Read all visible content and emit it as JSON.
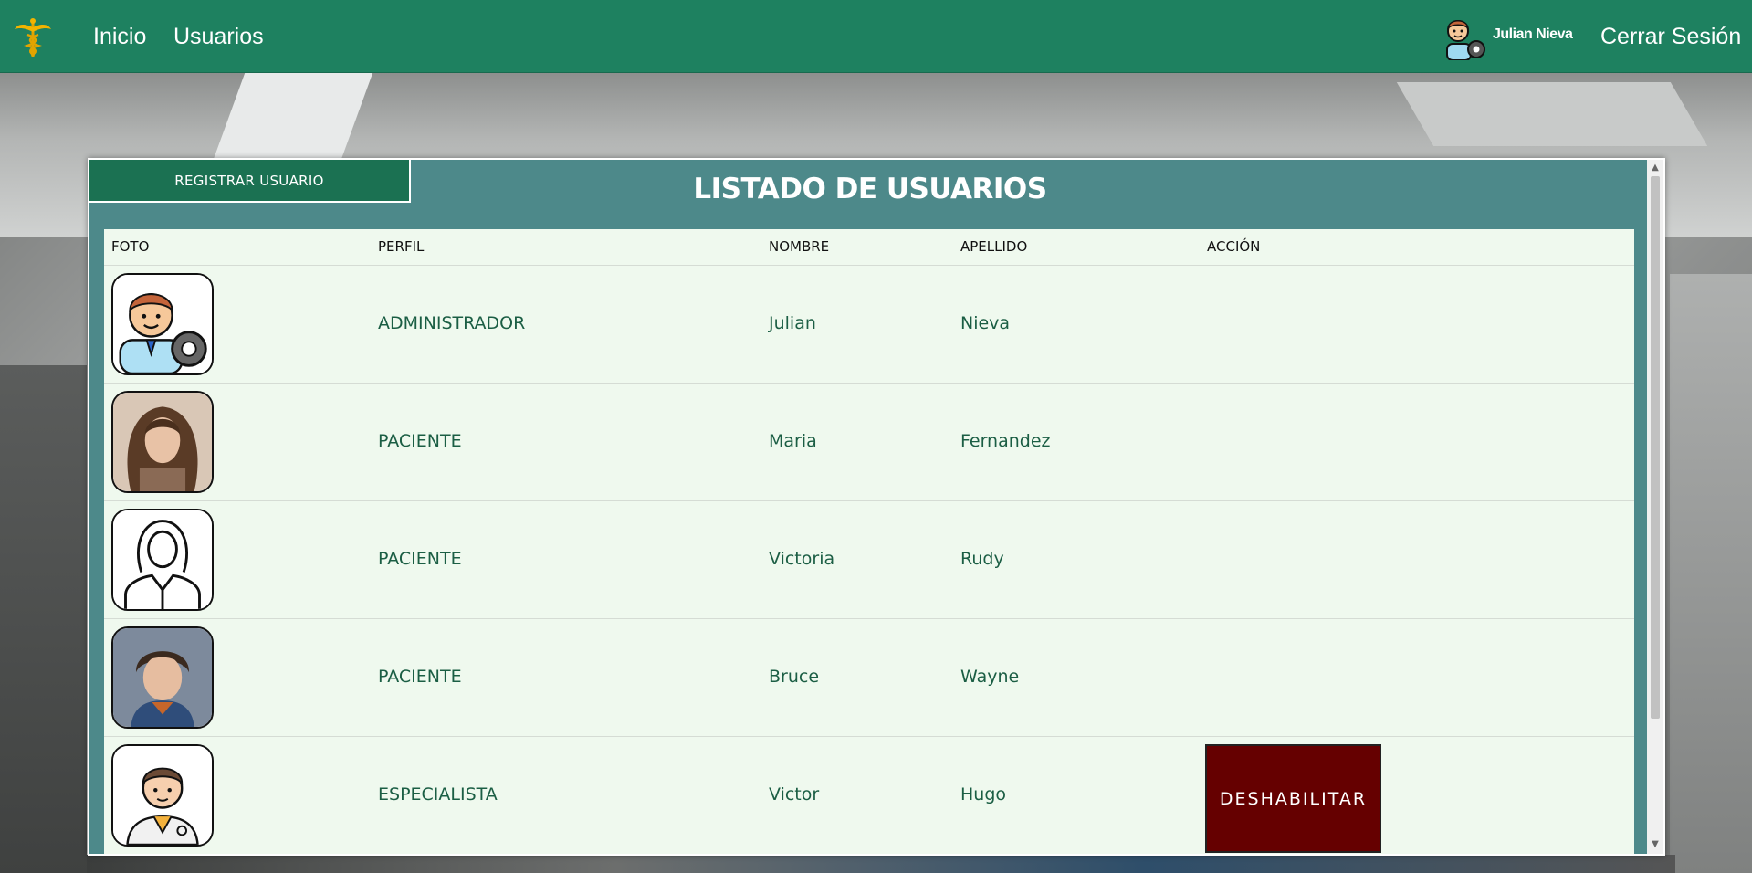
{
  "nav": {
    "links": {
      "inicio": "Inicio",
      "usuarios": "Usuarios"
    },
    "user_name": "Julian Nieva",
    "logout": "Cerrar Sesión",
    "color": "#1e8160"
  },
  "panel": {
    "register_button": "REGISTRAR USUARIO",
    "title": "LISTADO DE USUARIOS",
    "columns": {
      "foto": "FOTO",
      "perfil": "PERFIL",
      "nombre": "NOMBRE",
      "apellido": "APELLIDO",
      "accion": "ACCIÓN"
    },
    "rows": [
      {
        "photo_icon": "admin-avatar-icon",
        "perfil": "ADMINISTRADOR",
        "nombre": "Julian",
        "apellido": "Nieva",
        "accion": ""
      },
      {
        "photo_icon": "woman-photo",
        "perfil": "PACIENTE",
        "nombre": "Maria",
        "apellido": "Fernandez",
        "accion": ""
      },
      {
        "photo_icon": "woman-outline-icon",
        "perfil": "PACIENTE",
        "nombre": "Victoria",
        "apellido": "Rudy",
        "accion": ""
      },
      {
        "photo_icon": "man-photo",
        "perfil": "PACIENTE",
        "nombre": "Bruce",
        "apellido": "Wayne",
        "accion": ""
      },
      {
        "photo_icon": "doctor-avatar-icon",
        "perfil": "ESPECIALISTA",
        "nombre": "Victor",
        "apellido": "Hugo",
        "accion": "DESHABILITAR"
      }
    ],
    "disable_color": "#650000"
  }
}
